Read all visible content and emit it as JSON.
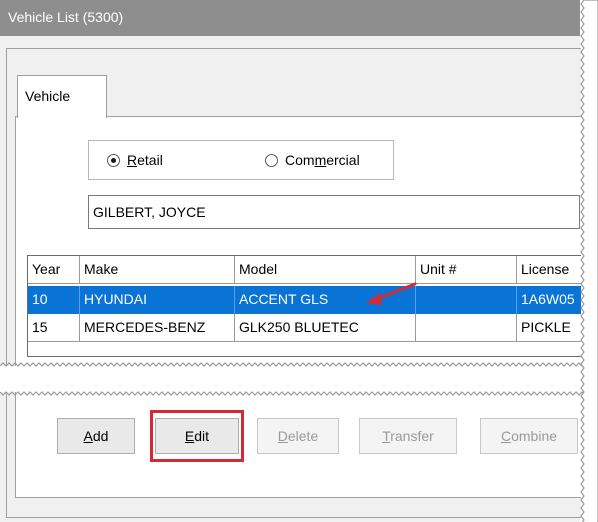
{
  "window": {
    "title": "Vehicle List (5300)"
  },
  "tabs": [
    {
      "label": "Vehicle"
    }
  ],
  "customer_type": {
    "selected": "Retail",
    "options": [
      {
        "label": "Retail",
        "underline_index": 0,
        "before": "",
        "hot": "R",
        "after": "etail"
      },
      {
        "label": "Commercial",
        "before": "Com",
        "hot": "m",
        "after": "ercial"
      }
    ]
  },
  "customer": {
    "name": "GILBERT, JOYCE"
  },
  "vehicles": {
    "columns": [
      "Year",
      "Make",
      "Model",
      "Unit #",
      "License"
    ],
    "rows": [
      {
        "year": "10",
        "make": "HYUNDAI",
        "model": "ACCENT GLS",
        "unit": "",
        "license": "1A6W05"
      },
      {
        "year": "15",
        "make": "MERCEDES-BENZ",
        "model": "GLK250 BLUETEC",
        "unit": "",
        "license": "PICKLE"
      }
    ],
    "selected_row": 0
  },
  "buttons": {
    "add": {
      "before": "",
      "hot": "A",
      "after": "dd"
    },
    "edit": {
      "before": "",
      "hot": "E",
      "after": "dit"
    },
    "delete": {
      "before": "",
      "hot": "D",
      "after": "elete"
    },
    "transfer": {
      "before": "",
      "hot": "T",
      "after": "ransfer"
    },
    "combine": {
      "before": "",
      "hot": "C",
      "after": "ombine"
    }
  },
  "colors": {
    "selection": "#0a74d6",
    "annotation": "#d42a36",
    "titlebar": "#8e8e8e"
  }
}
